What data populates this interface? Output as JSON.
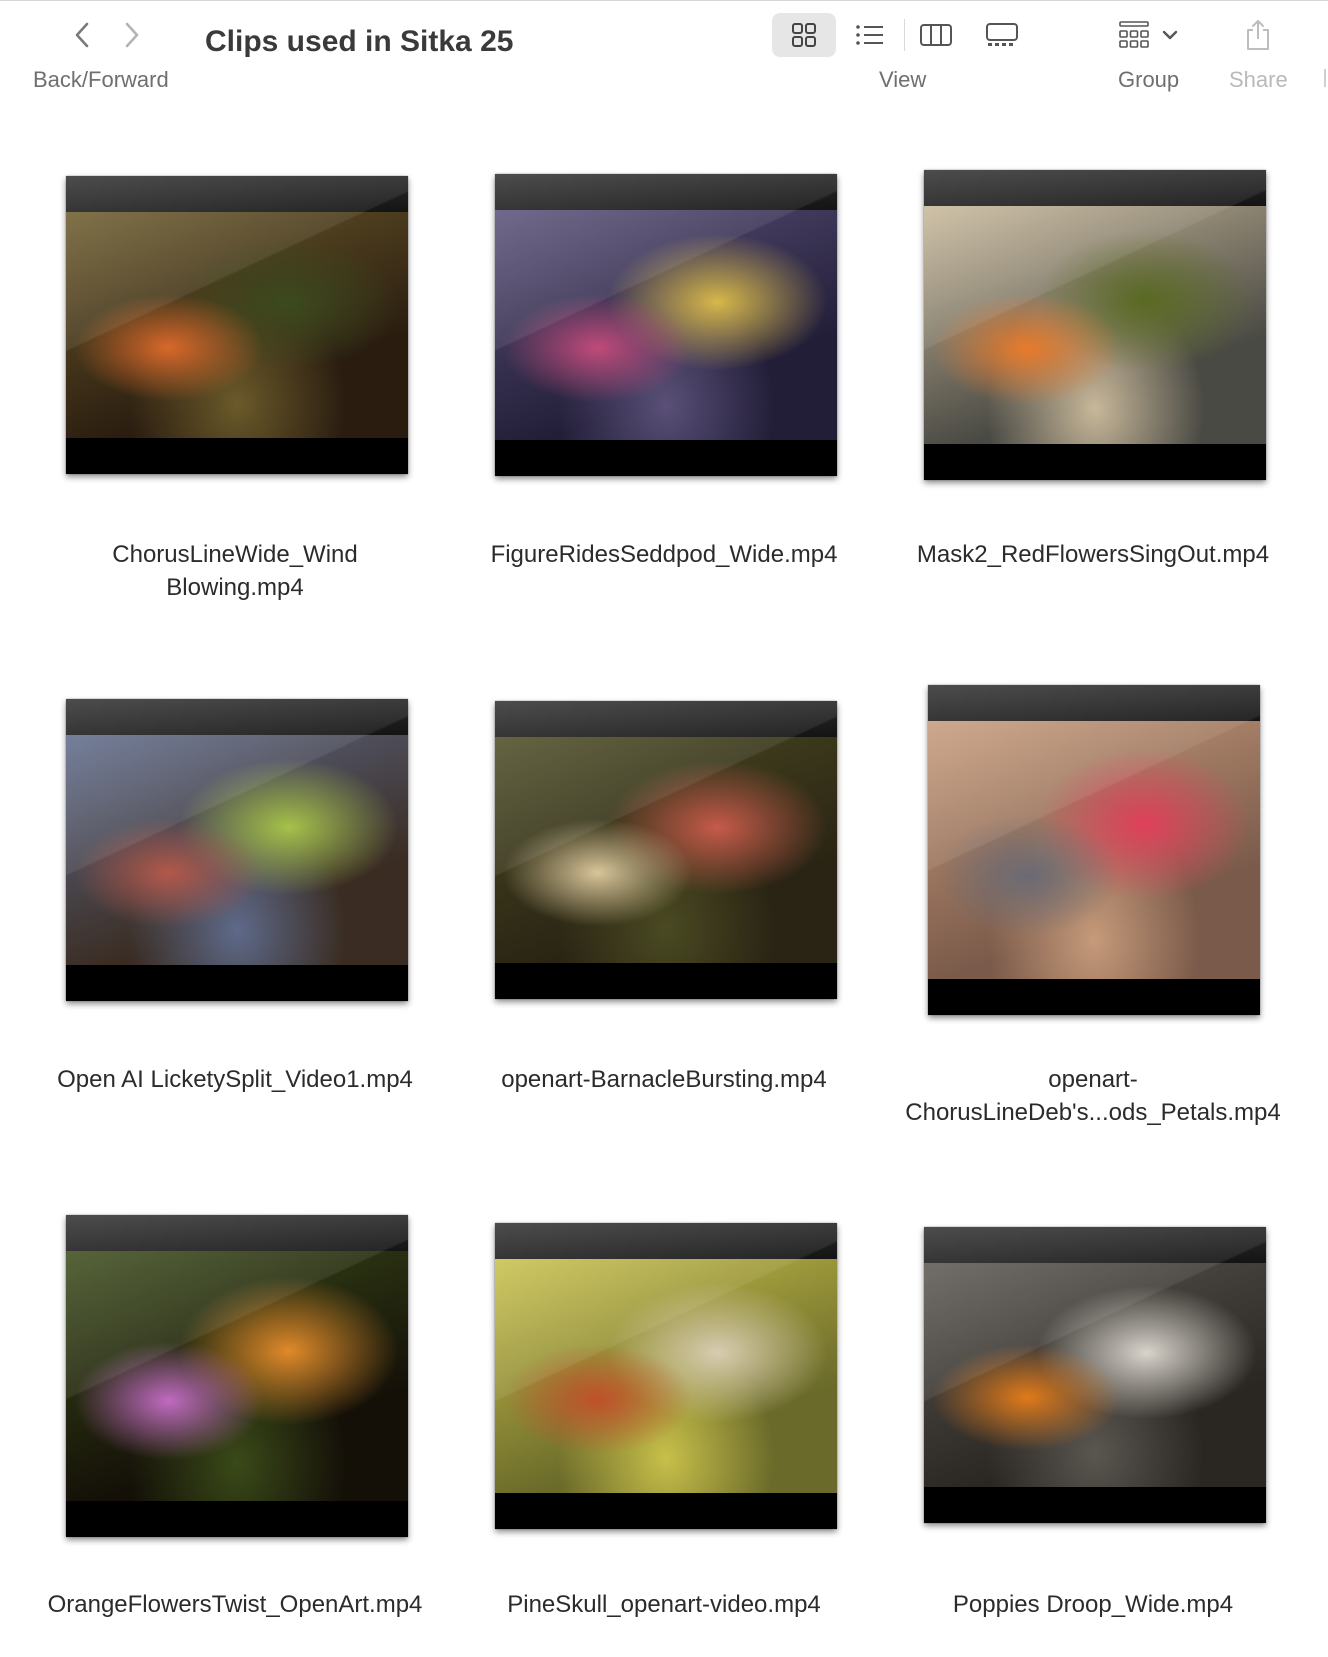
{
  "toolbar": {
    "back_icon": "chevron-left-icon",
    "forward_icon": "chevron-right-icon",
    "backforward_label": "Back/Forward",
    "title": "Clips used in Sitka 25",
    "view_label": "View",
    "view_modes": [
      "icon-view",
      "list-view",
      "column-view",
      "gallery-view"
    ],
    "active_view": "icon-view",
    "group_label": "Group",
    "share_label": "Share"
  },
  "files": [
    {
      "name_lines": [
        "ChorusLineWide_Wind",
        "Blowing.mp4"
      ],
      "palette": [
        "#2a1d10",
        "#6b5a2a",
        "#3c4a1e",
        "#d8682a"
      ]
    },
    {
      "name_lines": [
        "FigureRidesSeddpod_Wide.mp4"
      ],
      "palette": [
        "#221e38",
        "#5a5078",
        "#d7b84a",
        "#c04a7a"
      ]
    },
    {
      "name_lines": [
        "Mask2_RedFlowersSingOut.mp4"
      ],
      "palette": [
        "#4a4a44",
        "#c8b89a",
        "#5a6a22",
        "#e87a2a"
      ]
    },
    {
      "name_lines": [
        "Open AI LicketySplit_Video1.mp4"
      ],
      "palette": [
        "#3a2c22",
        "#5e6a8a",
        "#a6c24a",
        "#b2584a"
      ]
    },
    {
      "name_lines": [
        "openart-BarnacleBursting.mp4"
      ],
      "palette": [
        "#2a2414",
        "#4a4a22",
        "#c65a4a",
        "#d8c49a"
      ]
    },
    {
      "name_lines": [
        "openart-",
        "ChorusLineDeb's...ods_Petals.mp4"
      ],
      "palette": [
        "#7a5a4a",
        "#c69a7a",
        "#e0405a",
        "#6a6a74"
      ]
    },
    {
      "name_lines": [
        "OrangeFlowersTwist_OpenArt.mp4"
      ],
      "palette": [
        "#141008",
        "#3a4a18",
        "#e08a2a",
        "#c06ac0"
      ]
    },
    {
      "name_lines": [
        "PineSkull_openart-video.mp4"
      ],
      "palette": [
        "#6a6a2a",
        "#c8c04a",
        "#d8ccb0",
        "#c0502a"
      ]
    },
    {
      "name_lines": [
        "Poppies Droop_Wide.mp4"
      ],
      "palette": [
        "#2a2622",
        "#5a5650",
        "#d8d4cc",
        "#e07a1a"
      ]
    }
  ]
}
